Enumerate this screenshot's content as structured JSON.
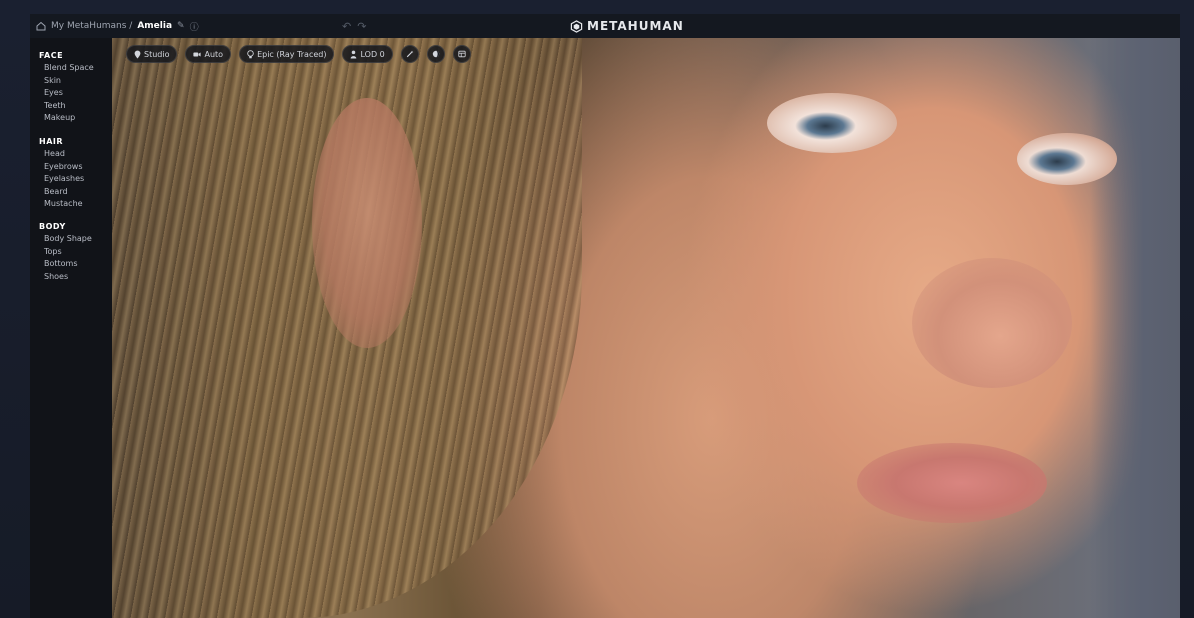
{
  "app": {
    "logo_text": "METAHUMAN",
    "breadcrumb": {
      "parent": "My MetaHumans /",
      "current": "Amelia"
    }
  },
  "toolbar": {
    "items": [
      {
        "label": "Studio",
        "icon": "location-pin-icon"
      },
      {
        "label": "Auto",
        "icon": "camera-icon"
      },
      {
        "label": "Epic (Ray Traced)",
        "icon": "lightbulb-icon"
      },
      {
        "label": "LOD 0",
        "icon": "person-icon"
      },
      {
        "label": "",
        "icon": "wand-icon"
      },
      {
        "label": "",
        "icon": "sphere-icon"
      },
      {
        "label": "",
        "icon": "grid-icon"
      }
    ]
  },
  "sidebar": {
    "face": {
      "title": "FACE",
      "items": [
        "Blend Space",
        "Skin",
        "Eyes",
        "Teeth",
        "Makeup"
      ]
    },
    "hair": {
      "title": "HAIR",
      "items": [
        "Head",
        "Eyebrows",
        "Eyelashes",
        "Beard",
        "Mustache"
      ]
    },
    "body": {
      "title": "BODY",
      "items": [
        "Body Shape",
        "Tops",
        "Bottoms",
        "Shoes"
      ]
    }
  },
  "colors": {
    "frame": "#1a2030",
    "sidebar": "#111318",
    "titlebar": "#141820",
    "text_primary": "#ffffff",
    "text_secondary": "#b9bdc6"
  }
}
